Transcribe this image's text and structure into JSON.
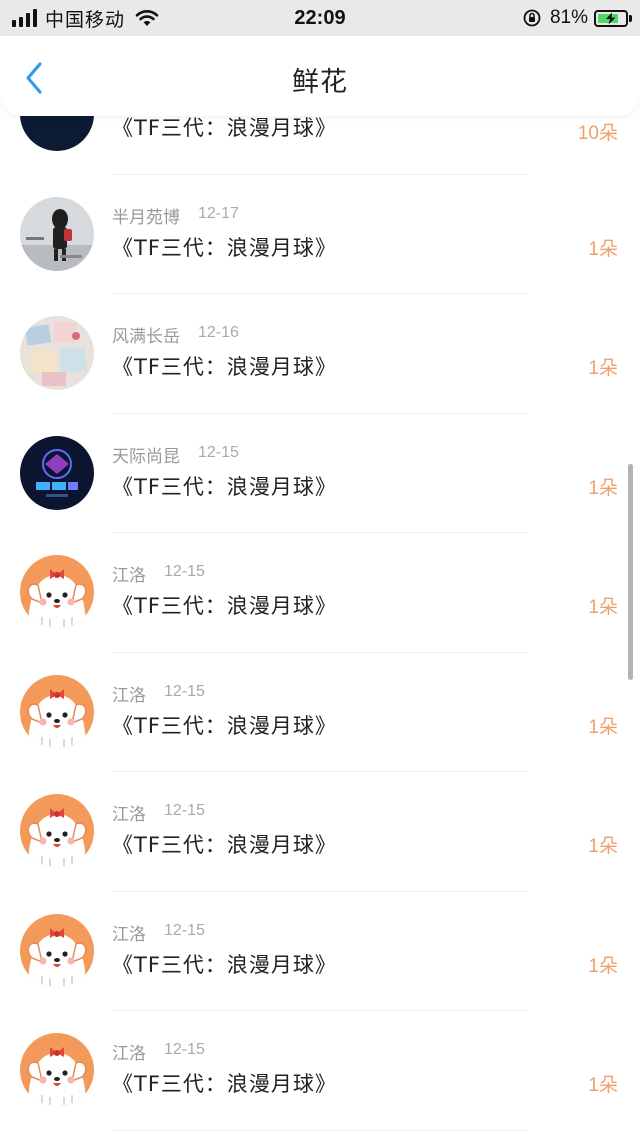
{
  "status_bar": {
    "carrier": "中国移动",
    "time": "22:09",
    "battery_percent": "81%",
    "battery_level": 0.81,
    "battery_color": "#4cd964"
  },
  "nav": {
    "back_icon": "chevron-left-icon",
    "title": "鲜花",
    "accent_color": "#2f9cf0"
  },
  "list": {
    "count_color": "#f0a06a",
    "items": [
      {
        "user": "",
        "date": "",
        "book": "《TF三代：浪漫月球》",
        "count": "10朵",
        "avatar": "carousel"
      },
      {
        "user": "半月苑博",
        "date": "12-17",
        "book": "《TF三代：浪漫月球》",
        "count": "1朵",
        "avatar": "girl-photo"
      },
      {
        "user": "风满长岳",
        "date": "12-16",
        "book": "《TF三代：浪漫月球》",
        "count": "1朵",
        "avatar": "photos-collage"
      },
      {
        "user": "天际尚昆",
        "date": "12-15",
        "book": "《TF三代：浪漫月球》",
        "count": "1朵",
        "avatar": "dark-tech"
      },
      {
        "user": "江洛",
        "date": "12-15",
        "book": "《TF三代：浪漫月球》",
        "count": "1朵",
        "avatar": "cartoon-dog"
      },
      {
        "user": "江洛",
        "date": "12-15",
        "book": "《TF三代：浪漫月球》",
        "count": "1朵",
        "avatar": "cartoon-dog"
      },
      {
        "user": "江洛",
        "date": "12-15",
        "book": "《TF三代：浪漫月球》",
        "count": "1朵",
        "avatar": "cartoon-dog"
      },
      {
        "user": "江洛",
        "date": "12-15",
        "book": "《TF三代：浪漫月球》",
        "count": "1朵",
        "avatar": "cartoon-dog"
      },
      {
        "user": "江洛",
        "date": "12-15",
        "book": "《TF三代：浪漫月球》",
        "count": "1朵",
        "avatar": "cartoon-dog"
      }
    ]
  }
}
